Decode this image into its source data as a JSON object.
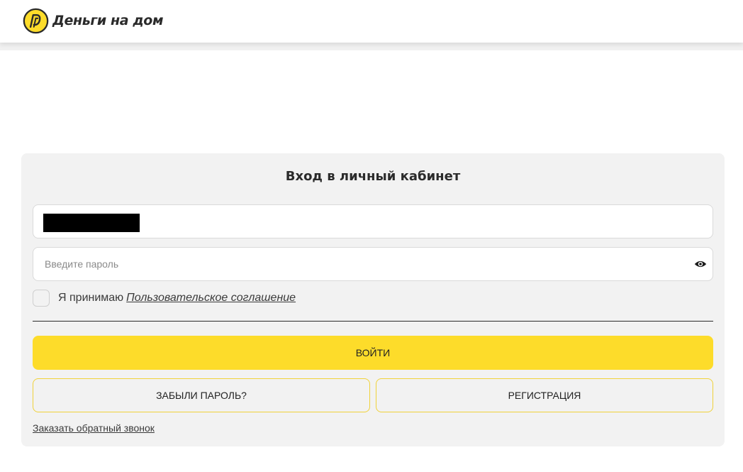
{
  "header": {
    "logo_text": "Деньги на дом",
    "logo_icon": "dd-coin-logo-icon",
    "brand_color": "#FDDC2A"
  },
  "login_form": {
    "title": "Вход в личный кабинет",
    "login_field": {
      "value": "",
      "redacted": true
    },
    "password_field": {
      "placeholder": "Введите пароль",
      "toggle_icon": "eye-icon"
    },
    "agreement": {
      "checked": false,
      "text": "Я принимаю",
      "link": "Пользовательское соглашение"
    },
    "submit_label": "ВОЙТИ",
    "forgot_label": "ЗАБЫЛИ ПАРОЛЬ?",
    "register_label": "РЕГИСТРАЦИЯ",
    "callback_link": "Заказать обратный звонок"
  },
  "colors": {
    "accent": "#FDDC2A",
    "card_bg": "#F2F2F2",
    "outline_border": "#F0D23A"
  }
}
